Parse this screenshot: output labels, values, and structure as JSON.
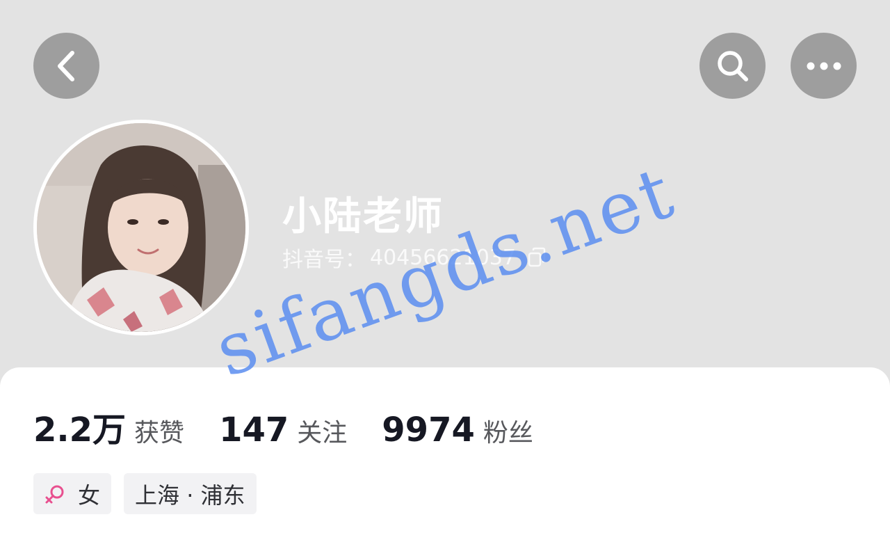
{
  "header": {
    "back_icon": "chevron-left-icon",
    "search_icon": "search-icon",
    "more_icon": "more-horizontal-icon"
  },
  "profile": {
    "nickname": "小陆老师",
    "douyin_id_label": "抖音号：",
    "douyin_id_value": "40456621037",
    "copy_icon": "copy-icon"
  },
  "watermark": {
    "text": "sifangds.net"
  },
  "stats": [
    {
      "value": "2.2万",
      "label": "获赞"
    },
    {
      "value": "147",
      "label": "关注"
    },
    {
      "value": "9974",
      "label": "粉丝"
    }
  ],
  "tags": {
    "gender": "女",
    "location": "上海 · 浦东"
  },
  "colors": {
    "header_bg": "#e3e3e3",
    "button_bg": "#9e9e9e",
    "text_primary": "#161823",
    "text_secondary": "#57585c",
    "tag_bg": "#f2f2f4",
    "female_icon": "#e8508f",
    "watermark": "#5b8ef0"
  }
}
